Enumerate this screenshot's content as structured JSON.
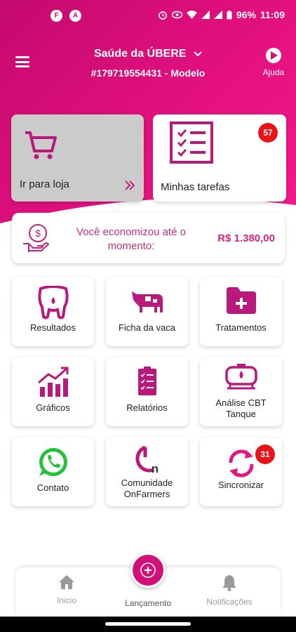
{
  "status_bar": {
    "left_icons": [
      "F",
      "A"
    ],
    "battery": "96%",
    "time": "11:09"
  },
  "header": {
    "farm_name": "Saúde da ÚBERE",
    "farm_id": "#179719554431 - Modelo",
    "help_label": "Ajuda"
  },
  "cards": {
    "store_label": "Ir para loja",
    "tasks_label": "Minhas tarefas",
    "tasks_badge": "57"
  },
  "savings": {
    "text": "Você economizou até o momento:",
    "amount": "R$ 1.380,00"
  },
  "tiles": [
    {
      "label": "Resultados",
      "icon": "udder-icon"
    },
    {
      "label": "Ficha da vaca",
      "icon": "cow-icon"
    },
    {
      "label": "Tratamentos",
      "icon": "folder-plus-icon"
    },
    {
      "label": "Gráficos",
      "icon": "chart-icon"
    },
    {
      "label": "Relatórios",
      "icon": "report-icon"
    },
    {
      "label": "Análise CBT Tanque",
      "icon": "tank-icon"
    },
    {
      "label": "Contato",
      "icon": "whatsapp-icon"
    },
    {
      "label": "Comunidade OnFarmers",
      "icon": "onfarmers-icon"
    },
    {
      "label": "Sincronizar",
      "icon": "sync-icon",
      "badge": "31"
    }
  ],
  "bottom_nav": {
    "home": "Inicio",
    "launch": "Lançamento",
    "notifications": "Notificações"
  },
  "colors": {
    "brand": "#d2107a",
    "badge": "#e8141a",
    "whatsapp": "#25c13b"
  }
}
